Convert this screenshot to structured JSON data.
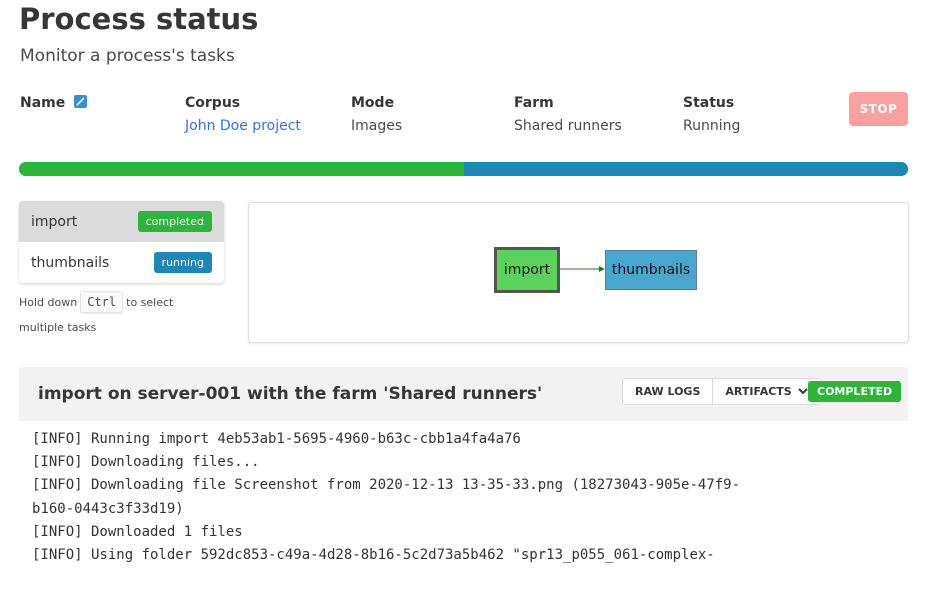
{
  "page": {
    "title": "Process status",
    "subtitle": "Monitor a process's tasks"
  },
  "info": {
    "name_label": "Name",
    "corpus_label": "Corpus",
    "corpus_value": "John Doe project",
    "mode_label": "Mode",
    "mode_value": "Images",
    "farm_label": "Farm",
    "farm_value": "Shared runners",
    "status_label": "Status",
    "status_value": "Running"
  },
  "actions": {
    "stop_label": "STOP"
  },
  "progress": {
    "completed_fraction": 0.5
  },
  "tasks": [
    {
      "name": "import",
      "status": "completed"
    },
    {
      "name": "thumbnails",
      "status": "running"
    }
  ],
  "hint": {
    "before": "Hold down",
    "key": "Ctrl",
    "after": "to select multiple tasks"
  },
  "graph": {
    "nodes": [
      "import",
      "thumbnails"
    ]
  },
  "log": {
    "title": "import on server-001 with the farm 'Shared runners'",
    "raw_logs_label": "RAW LOGS",
    "artifacts_label": "ARTIFACTS",
    "status_label": "COMPLETED",
    "lines": [
      "[INFO] Running import 4eb53ab1-5695-4960-b63c-cbb1a4fa4a76",
      "[INFO] Downloading files...",
      "[INFO] Downloading file Screenshot from 2020-12-13 13-35-33.png (18273043-905e-47f9-",
      "b160-0443c3f33d19)",
      "[INFO] Downloaded 1 files",
      "[INFO] Using folder 592dc853-c49a-4d28-8b16-5c2d73a5b462 \"spr13_p055_061-complex-"
    ]
  },
  "colors": {
    "completed": "#2db43a",
    "running": "#1f87b8",
    "stop": "#f9a1a1",
    "link": "#3273dc"
  }
}
